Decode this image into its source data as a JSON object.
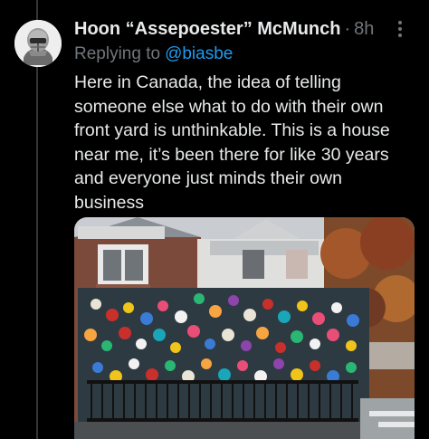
{
  "tweet": {
    "author": {
      "display_name": "Hoon “Assepoester” McMunch",
      "avatar_icon": "helmet-avatar-icon"
    },
    "separator": "·",
    "timestamp": "8h",
    "reply_prefix": "Replying to",
    "reply_handle": "@biasbe",
    "text_lines": [
      "Here in Canada, the idea of telling",
      "someone else what to do with their own",
      "front yard is unthinkable. This is a house",
      "near me, it’s been there for like 30 years",
      "and everyone just minds their own",
      "business"
    ],
    "more_icon": "more-vertical-icon"
  },
  "colors": {
    "background": "#000000",
    "primary_text": "#e7e9ea",
    "secondary_text": "#71767b",
    "link": "#1d9bf0",
    "thread_line": "#333639"
  }
}
